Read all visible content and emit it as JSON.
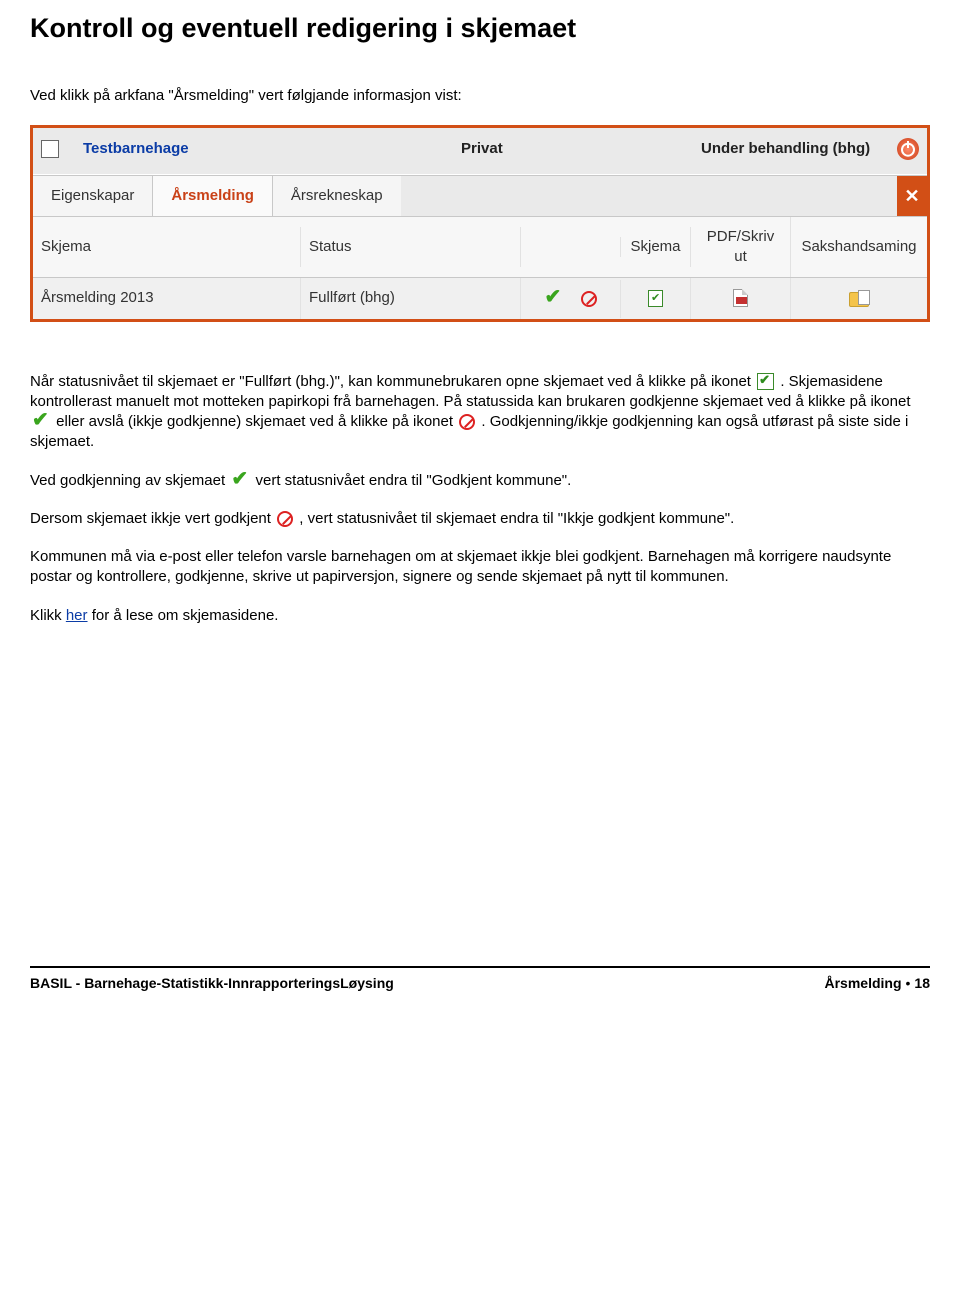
{
  "heading": "Kontroll og eventuell redigering i skjemaet",
  "intro": "Ved klikk på arkfana \"Årsmelding\" vert følgjande informasjon vist:",
  "app": {
    "name": "Testbarnehage",
    "type": "Privat",
    "status": "Under behandling (bhg)",
    "tabs": [
      "Eigenskapar",
      "Årsmelding",
      "Årsrekneskap"
    ],
    "columns": {
      "skjema": "Skjema",
      "status": "Status",
      "skjema2": "Skjema",
      "pdf": "PDF/Skriv ut",
      "saks": "Sakshandsaming"
    },
    "row": {
      "skjema": "Årsmelding 2013",
      "status": "Fullført (bhg)"
    }
  },
  "p1a": "Når statusnivået til skjemaet er \"Fullført (bhg.)\",  kan kommunebrukaren opne skjemaet ved å klikke på ikonet ",
  "p1b": ". Skjemasidene kontrollerast manuelt mot motteken papirkopi frå barnehagen. På statussida kan brukaren godkjenne skjemaet ved å klikke på ikonet ",
  "p1c": " eller avslå (ikkje godkjenne) skjemaet ved å klikke på ikonet ",
  "p1d": ". Godkjenning/ikkje godkjenning kan også utførast på siste side i skjemaet.",
  "p2a": "Ved godkjenning av skjemaet ",
  "p2b": " vert statusnivået endra til \"Godkjent kommune\".",
  "p3a": "Dersom skjemaet ikkje vert godkjent ",
  "p3b": ", vert statusnivået til skjemaet endra til \"Ikkje godkjent kommune\".",
  "p4": "Kommunen må via e-post eller telefon varsle barnehagen om at skjemaet ikkje blei godkjent. Barnehagen må korrigere naudsynte postar og kontrollere, godkjenne, skrive ut papirversjon, signere og sende skjemaet på nytt til kommunen.",
  "p5a": "Klikk ",
  "p5link": "her",
  "p5b": " for å lese om skjemasidene.",
  "footer": {
    "left": "BASIL - Barnehage-Statistikk-InnrapporteringsLøysing",
    "right_label": "Årsmelding",
    "right_page": "18"
  }
}
